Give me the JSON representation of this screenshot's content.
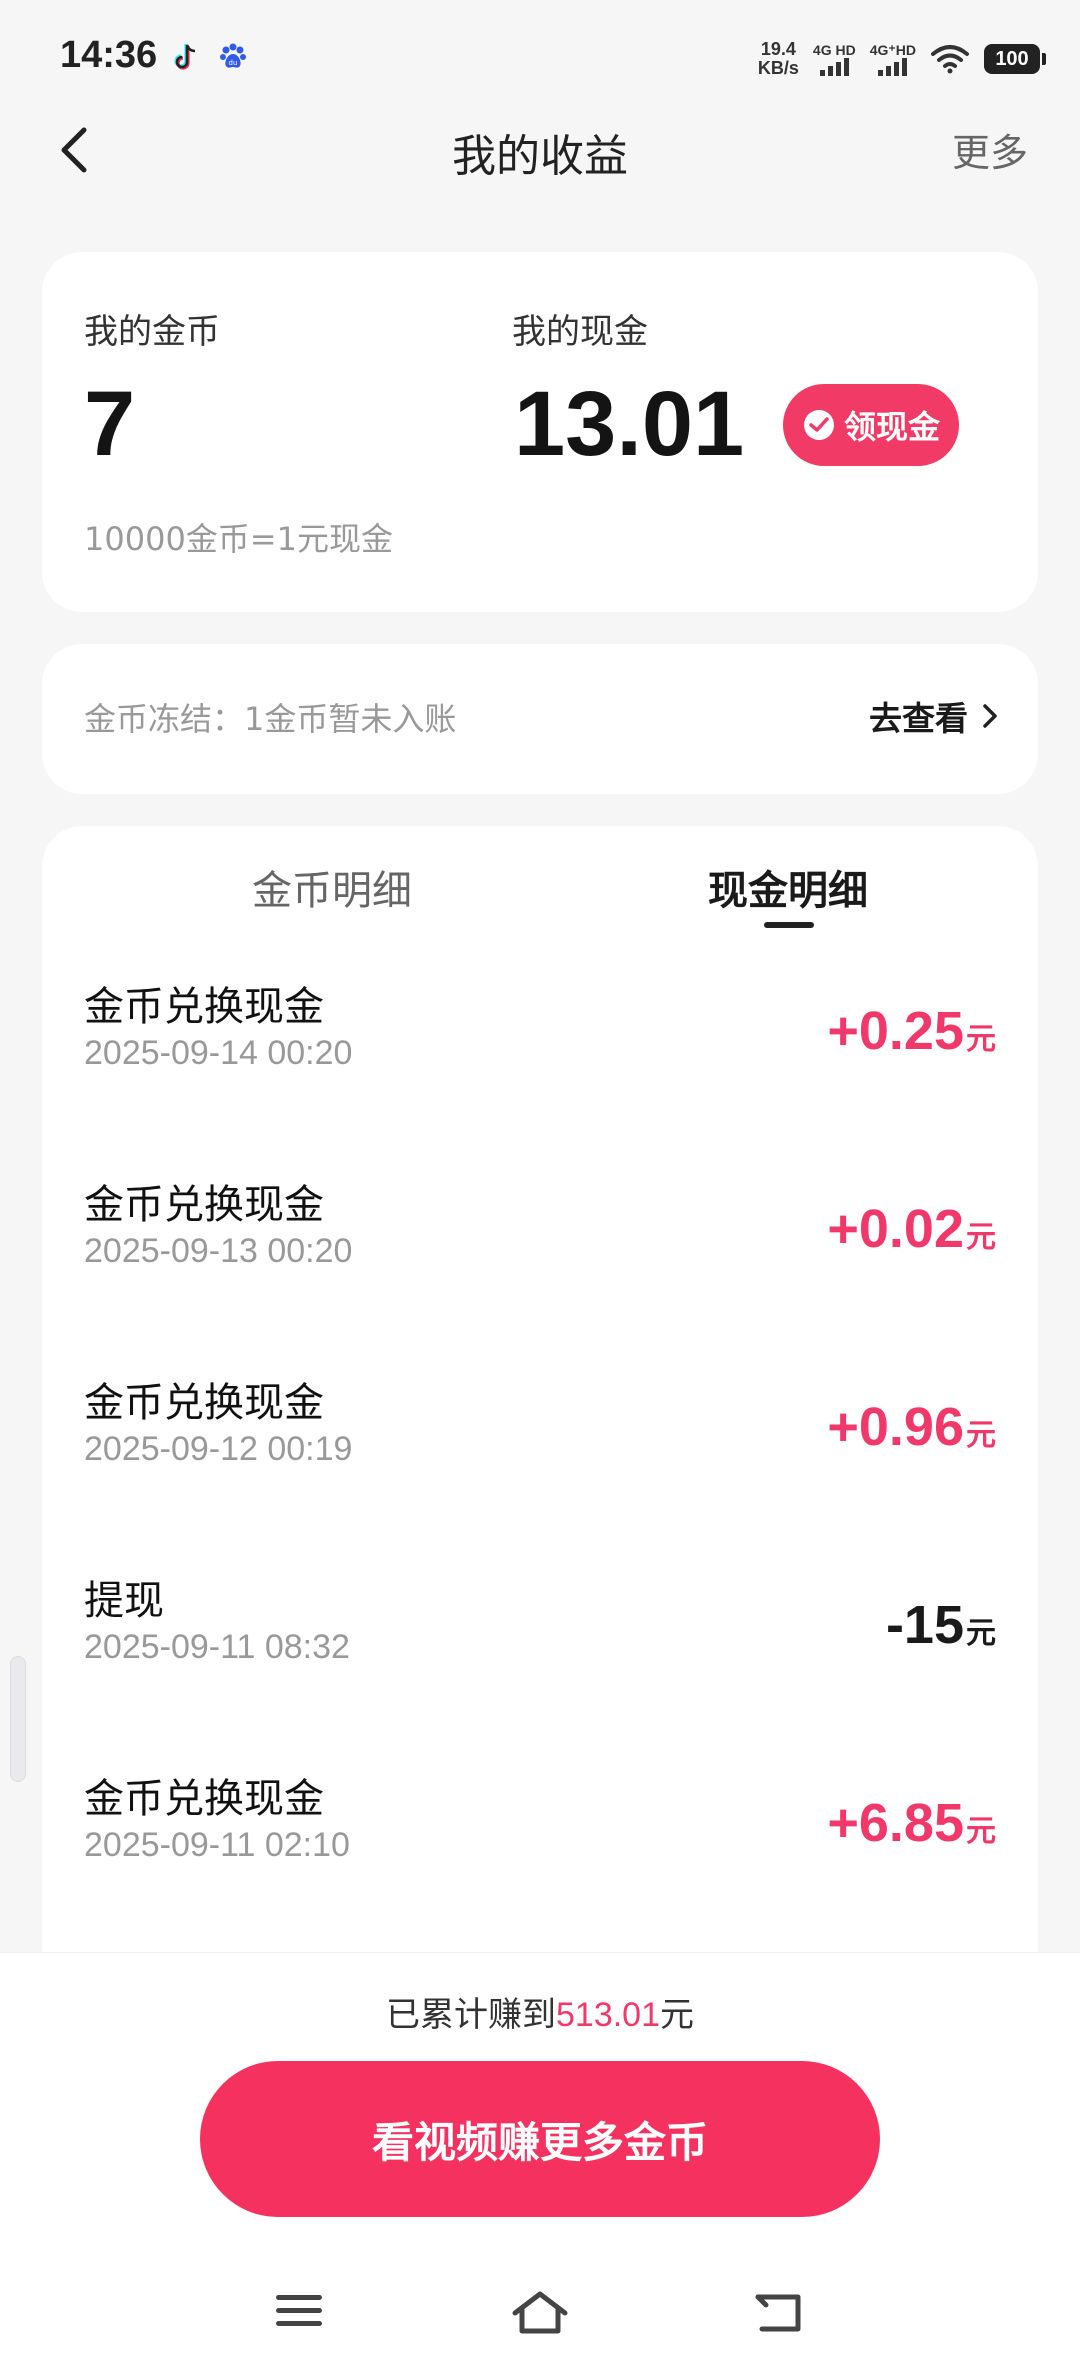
{
  "status_bar": {
    "time": "14:36",
    "speed_value": "19.4",
    "speed_unit": "KB/s",
    "net1": "4G HD",
    "net2": "4G⁺HD",
    "battery": "100",
    "icons": [
      "tiktok-icon",
      "baidu-icon",
      "signal-icon",
      "wifi-icon",
      "battery-icon"
    ]
  },
  "nav": {
    "title": "我的收益",
    "more": "更多",
    "back_icon": "chevron-left-icon"
  },
  "balance": {
    "coins_label": "我的金币",
    "coins_value": "7",
    "cash_label": "我的现金",
    "cash_value": "13.01",
    "withdraw_label": "领现金",
    "rate_text": "10000金币=1元现金"
  },
  "frozen": {
    "text": "金币冻结：1金币暂未入账",
    "link": "去查看"
  },
  "tabs": {
    "coins": "金币明细",
    "cash": "现金明细",
    "active": "cash"
  },
  "records": [
    {
      "title": "金币兑换现金",
      "date": "2025-09-14 00:20",
      "amount": "+0.25",
      "unit": "元",
      "positive": true
    },
    {
      "title": "金币兑换现金",
      "date": "2025-09-13 00:20",
      "amount": "+0.02",
      "unit": "元",
      "positive": true
    },
    {
      "title": "金币兑换现金",
      "date": "2025-09-12 00:19",
      "amount": "+0.96",
      "unit": "元",
      "positive": true
    },
    {
      "title": "提现",
      "date": "2025-09-11 08:32",
      "amount": "-15",
      "unit": "元",
      "positive": false
    },
    {
      "title": "金币兑换现金",
      "date": "2025-09-11 02:10",
      "amount": "+6.85",
      "unit": "元",
      "positive": true
    }
  ],
  "footer": {
    "total_prefix": "已累计赚到",
    "total_amount": "513.01",
    "total_suffix": "元",
    "button": "看视频赚更多金币"
  },
  "colors": {
    "accent": "#f0396a",
    "button": "#f5325f",
    "background": "#f6f6f6"
  }
}
